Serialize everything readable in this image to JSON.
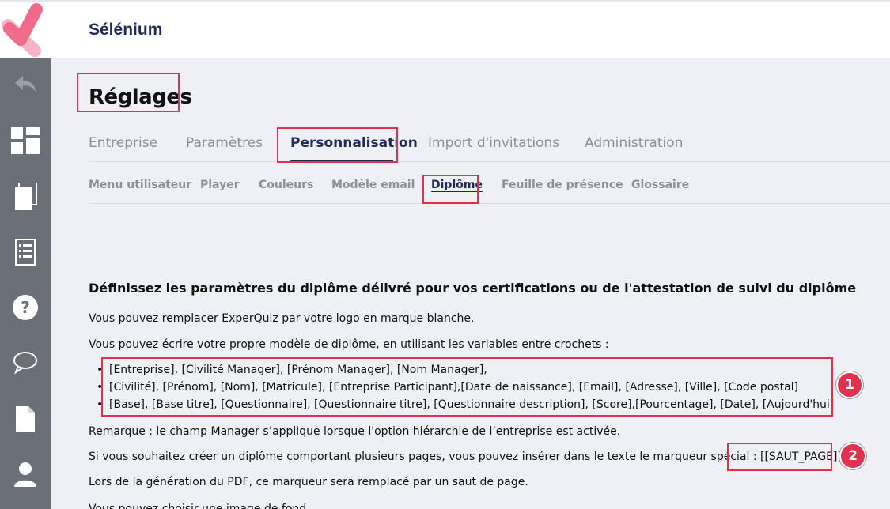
{
  "app": {
    "title": "Sélénium"
  },
  "page": {
    "title": "Réglages"
  },
  "tabs": [
    {
      "label": "Entreprise"
    },
    {
      "label": "Paramètres"
    },
    {
      "label": "Personnalisation"
    },
    {
      "label": "Import d'invitations"
    },
    {
      "label": "Administration"
    }
  ],
  "active_tab": "Personnalisation",
  "subtabs": [
    {
      "label": "Menu utilisateur"
    },
    {
      "label": "Player"
    },
    {
      "label": "Couleurs"
    },
    {
      "label": "Modèle email"
    },
    {
      "label": "Diplôme"
    },
    {
      "label": "Feuille de présence"
    },
    {
      "label": "Glossaire"
    }
  ],
  "active_subtab": "Diplôme",
  "sidebar": {
    "items": [
      {
        "icon": "back-arrow-icon"
      },
      {
        "icon": "dashboard-icon"
      },
      {
        "icon": "pages-icon"
      },
      {
        "icon": "list-icon"
      },
      {
        "icon": "help-icon"
      },
      {
        "icon": "chat-icon"
      },
      {
        "icon": "document-icon"
      },
      {
        "icon": "user-icon"
      }
    ]
  },
  "content": {
    "heading": "Définissez les paramètres du diplôme délivré pour vos certifications ou de l'attestation de suivi du diplôme",
    "p1": "Vous pouvez remplacer ExperQuiz par votre logo en marque blanche.",
    "p2": "Vous pouvez écrire votre propre modèle de diplôme, en utilisant les variables entre crochets :",
    "variables": [
      "[Entreprise], [Civilité Manager], [Prénom Manager], [Nom Manager],",
      "[Civilité], [Prénom], [Nom], [Matricule], [Entreprise Participant],[Date de naissance], [Email], [Adresse], [Ville], [Code postal]",
      "[Base], [Base titre], [Questionnaire], [Questionnaire titre], [Questionnaire description], [Score],[Pourcentage], [Date], [Aujourd'hui]"
    ],
    "remark": "Remarque : le champ Manager s’applique lorsque l'option hiérarchie de l’entreprise est activée.",
    "p3": "Si vous souhaitez créer un diplôme comportant plusieurs pages, vous pouvez insérer dans le texte le marqueur spécial :",
    "marker": "[[SAUT_PAGE]]",
    "p4": "Lors de la génération du PDF, ce marqueur sera remplacé par un saut de page.",
    "p5": "Vous pouvez choisir une image de fond"
  },
  "badges": [
    "1",
    "2"
  ],
  "colors": {
    "accent": "#e0314f",
    "navy": "#1f2a55",
    "sidebar": "#6b6f78",
    "logo_pink": "#f06a8c"
  }
}
